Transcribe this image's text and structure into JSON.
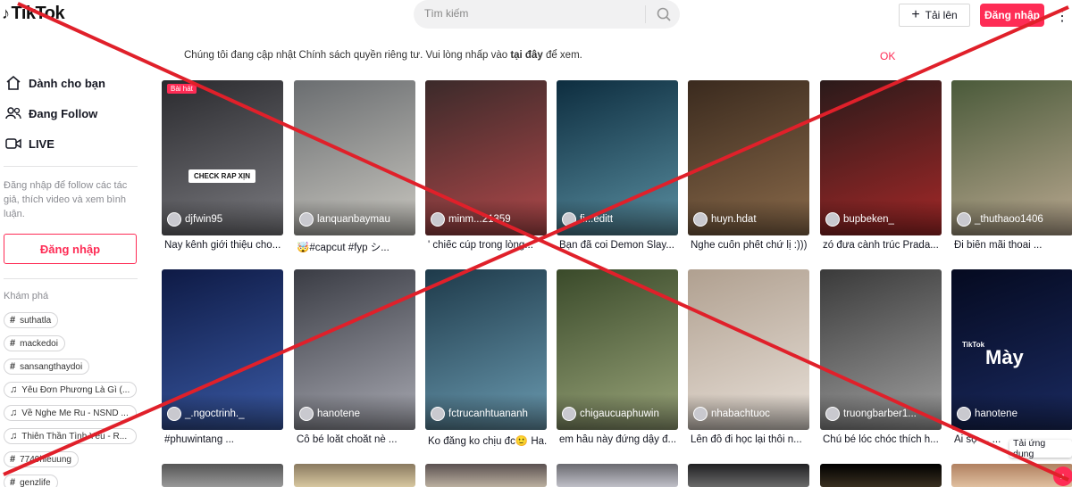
{
  "header": {
    "logo_text": "TikTok",
    "search_placeholder": "Tìm kiếm",
    "upload_label": "Tải lên",
    "login_label": "Đăng nhập"
  },
  "notice": {
    "text_before": "Chúng tôi đang cập nhật Chính sách quyền riêng tư. Vui lòng nhấp vào ",
    "link": "tại đây",
    "text_after": " để xem.",
    "ok": "OK"
  },
  "sidebar": {
    "nav": [
      {
        "label": "Dành cho bạn",
        "icon": "home-icon"
      },
      {
        "label": "Đang Follow",
        "icon": "users-icon"
      },
      {
        "label": "LIVE",
        "icon": "live-icon"
      }
    ],
    "note": "Đăng nhập để follow các tác giả, thích video và xem bình luận.",
    "login_label": "Đăng nhập",
    "explore_title": "Khám phá",
    "tags": [
      {
        "type": "hashtag",
        "label": "suthatla"
      },
      {
        "type": "hashtag",
        "label": "mackedoi"
      },
      {
        "type": "hashtag",
        "label": "sansangthaydoi"
      },
      {
        "type": "music",
        "label": "Yêu Đơn Phương Là Gì (..."
      },
      {
        "type": "music",
        "label": "Về Nghe Me Ru - NSND ..."
      },
      {
        "type": "music",
        "label": "Thiên Thần Tình Yêu - R..."
      },
      {
        "type": "hashtag",
        "label": "7749hieuung"
      },
      {
        "type": "hashtag",
        "label": "genzlife"
      }
    ]
  },
  "videos": [
    {
      "author": "djfwin95",
      "caption": "Nay kênh giới thiệu cho...",
      "colors": [
        "#2a2a2e",
        "#7b7b80"
      ],
      "overlay": "CHECK RAP XỊN",
      "badge": "Bài hát"
    },
    {
      "author": "lanquanbaymau",
      "caption": "🤯#capcut #fyp シ...",
      "colors": [
        "#6a6d70",
        "#c9c7c0"
      ]
    },
    {
      "author": "minm...21359",
      "caption": "' chiếc cúp trong lòng...",
      "colors": [
        "#3b2a2a",
        "#b0484a"
      ]
    },
    {
      "author": "fi...editt",
      "caption": "Bạn đã coi Demon Slay...",
      "colors": [
        "#0d2d3f",
        "#5a8fa1"
      ]
    },
    {
      "author": "huyn.hdat",
      "caption": "Nghe cuốn phết chứ lị :)))",
      "colors": [
        "#3a2a1e",
        "#8a6a4a"
      ]
    },
    {
      "author": "bupbeken_",
      "caption": "zó đưa cành trúc Prada...",
      "colors": [
        "#2a1a1a",
        "#a52828"
      ]
    },
    {
      "author": "_thuthaoo1406",
      "caption": "Đi biển mãi thoai ...",
      "colors": [
        "#4a5a3a",
        "#b9a890"
      ]
    },
    {
      "author": "_.ngoctrinh._",
      "caption": "#phuwintang ...",
      "colors": [
        "#0e1a45",
        "#3a5aa5"
      ]
    },
    {
      "author": "hanotene",
      "caption": "Cô bé loắt choắt nè ...",
      "colors": [
        "#3a3c44",
        "#a8a9b2"
      ]
    },
    {
      "author": "fctrucanhtuananh",
      "caption": "Ko đăng ko chịu đc🙂 Ha...",
      "colors": [
        "#1e3a4a",
        "#6a9ab0"
      ]
    },
    {
      "author": "chigaucuaphuwin",
      "caption": "em hầu này đứng dậy đ...",
      "colors": [
        "#3a4a2a",
        "#9aa57a"
      ]
    },
    {
      "author": "nhabachtuoc",
      "caption": "Lên đồ đi học lại thôi n...",
      "colors": [
        "#b0a090",
        "#e8e0d8"
      ]
    },
    {
      "author": "truongbarber1...",
      "caption": "Chú bé lóc chóc thích h...",
      "colors": [
        "#3a3a3a",
        "#a0a0a0"
      ]
    },
    {
      "author": "hanotene",
      "caption": "Ai sợ ... ...",
      "colors": [
        "#050a20",
        "#1a2a60"
      ],
      "overlay_big": "Mày",
      "overlay_tag": "TikTok"
    }
  ],
  "bottom_row_colors": [
    [
      "#555",
      "#999"
    ],
    [
      "#8a7a60",
      "#d8c8a0"
    ],
    [
      "#5a5050",
      "#bbb0a0"
    ],
    [
      "#6a6a70",
      "#c0c0c8"
    ],
    [
      "#202022",
      "#6a6a6a"
    ],
    [
      "#000",
      "#3a3020"
    ],
    [
      "#b08060",
      "#e0c0a0"
    ]
  ],
  "download_label": "Tải ứng dụng",
  "colors": {
    "brand": "#fe2c55",
    "cross": "#e0202a"
  }
}
